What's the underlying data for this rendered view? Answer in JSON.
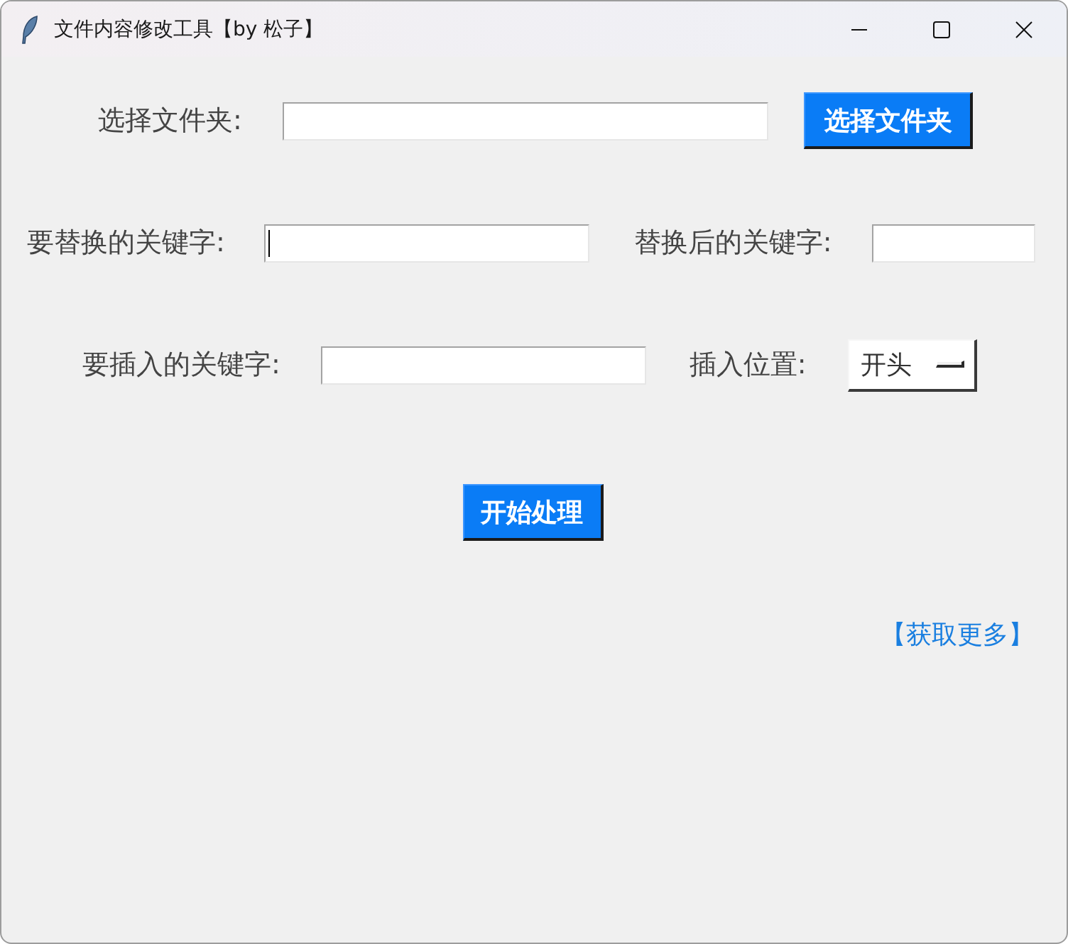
{
  "window": {
    "title": "文件内容修改工具【by 松子】"
  },
  "folder_row": {
    "label": "选择文件夹:",
    "button": "选择文件夹"
  },
  "replace_row": {
    "find_label": "要替换的关键字:",
    "find_focused": true,
    "replace_label": "替换后的关键字:"
  },
  "insert_row": {
    "label": "要插入的关键字:",
    "position_label": "插入位置:",
    "position_value": "开头"
  },
  "start_button": "开始处理",
  "more_link": "【获取更多】"
}
